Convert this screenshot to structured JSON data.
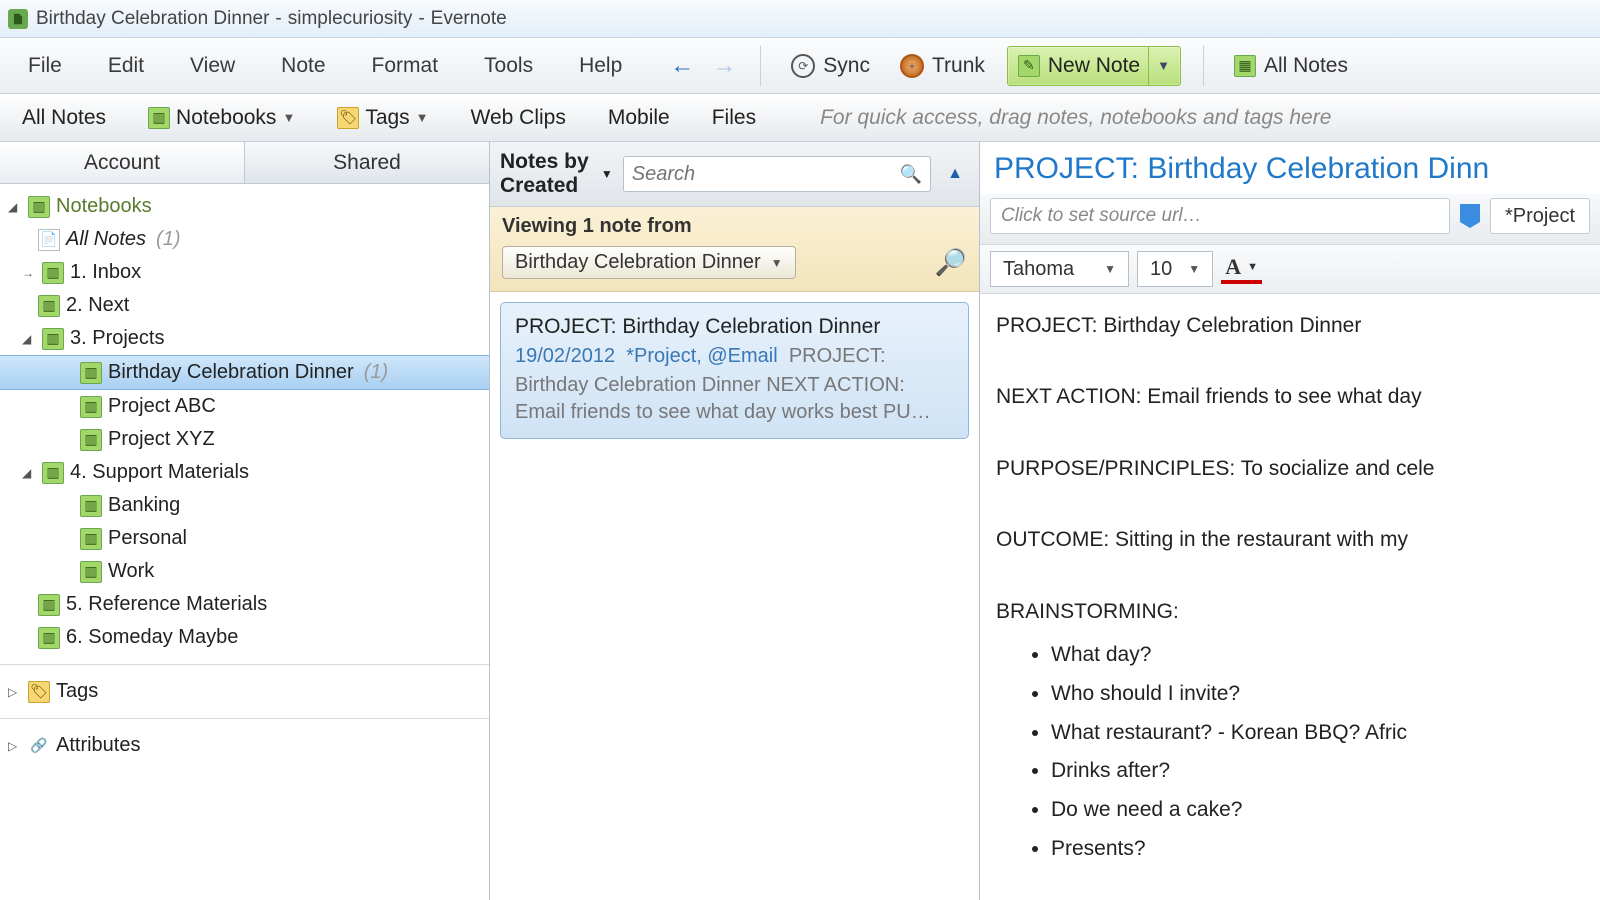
{
  "titlebar": {
    "note_name": "Birthday Celebration Dinner",
    "account": "simplecuriosity",
    "app": "Evernote"
  },
  "menubar": [
    "File",
    "Edit",
    "View",
    "Note",
    "Format",
    "Tools",
    "Help"
  ],
  "toolbar": {
    "sync": "Sync",
    "trunk": "Trunk",
    "new_note": "New Note",
    "all_notes": "All Notes"
  },
  "filterbar": {
    "all_notes": "All Notes",
    "notebooks": "Notebooks",
    "tags": "Tags",
    "web_clips": "Web Clips",
    "mobile": "Mobile",
    "files": "Files",
    "hint": "For quick access, drag notes, notebooks and tags here"
  },
  "sidebar": {
    "tabs": {
      "account": "Account",
      "shared": "Shared"
    },
    "root": "Notebooks",
    "all_notes": {
      "label": "All Notes",
      "count": "(1)"
    },
    "notebooks": [
      {
        "label": "1. Inbox"
      },
      {
        "label": "2. Next"
      },
      {
        "label": "3. Projects",
        "expanded": true,
        "children": [
          {
            "label": "Birthday Celebration Dinner",
            "count": "(1)",
            "selected": true
          },
          {
            "label": "Project ABC"
          },
          {
            "label": "Project XYZ"
          }
        ]
      },
      {
        "label": "4. Support Materials",
        "expanded": true,
        "children": [
          {
            "label": "Banking"
          },
          {
            "label": "Personal"
          },
          {
            "label": "Work"
          }
        ]
      },
      {
        "label": "5. Reference Materials"
      },
      {
        "label": "6. Someday Maybe"
      }
    ],
    "tags": "Tags",
    "attributes": "Attributes"
  },
  "listcol": {
    "sort_label": "Notes by Created",
    "search_placeholder": "Search",
    "viewing_line": "Viewing 1 note from",
    "viewing_notebook": "Birthday Celebration Dinner",
    "note": {
      "title": "PROJECT: Birthday Celebration Dinner",
      "date": "19/02/2012",
      "tags": "*Project, @Email",
      "snippet_inline": "PROJECT:",
      "snippet": "Birthday Celebration Dinner NEXT ACTION: Email friends to see what day works best PU…"
    }
  },
  "editor": {
    "title": "PROJECT: Birthday Celebration Dinn",
    "source_placeholder": "Click to set source url…",
    "tag": "*Project",
    "font_name": "Tahoma",
    "font_size": "10",
    "body": {
      "l1": "PROJECT: Birthday Celebration Dinner",
      "l2": "NEXT ACTION: Email friends to see what day",
      "l3": "PURPOSE/PRINCIPLES: To socialize and cele",
      "l4": "OUTCOME: Sitting in the restaurant with my",
      "l5": "BRAINSTORMING:",
      "bullets": [
        "What day?",
        "Who should I invite?",
        "What restaurant? - Korean BBQ? Afric",
        "Drinks after?",
        "Do we need a cake?",
        "Presents?"
      ]
    }
  }
}
